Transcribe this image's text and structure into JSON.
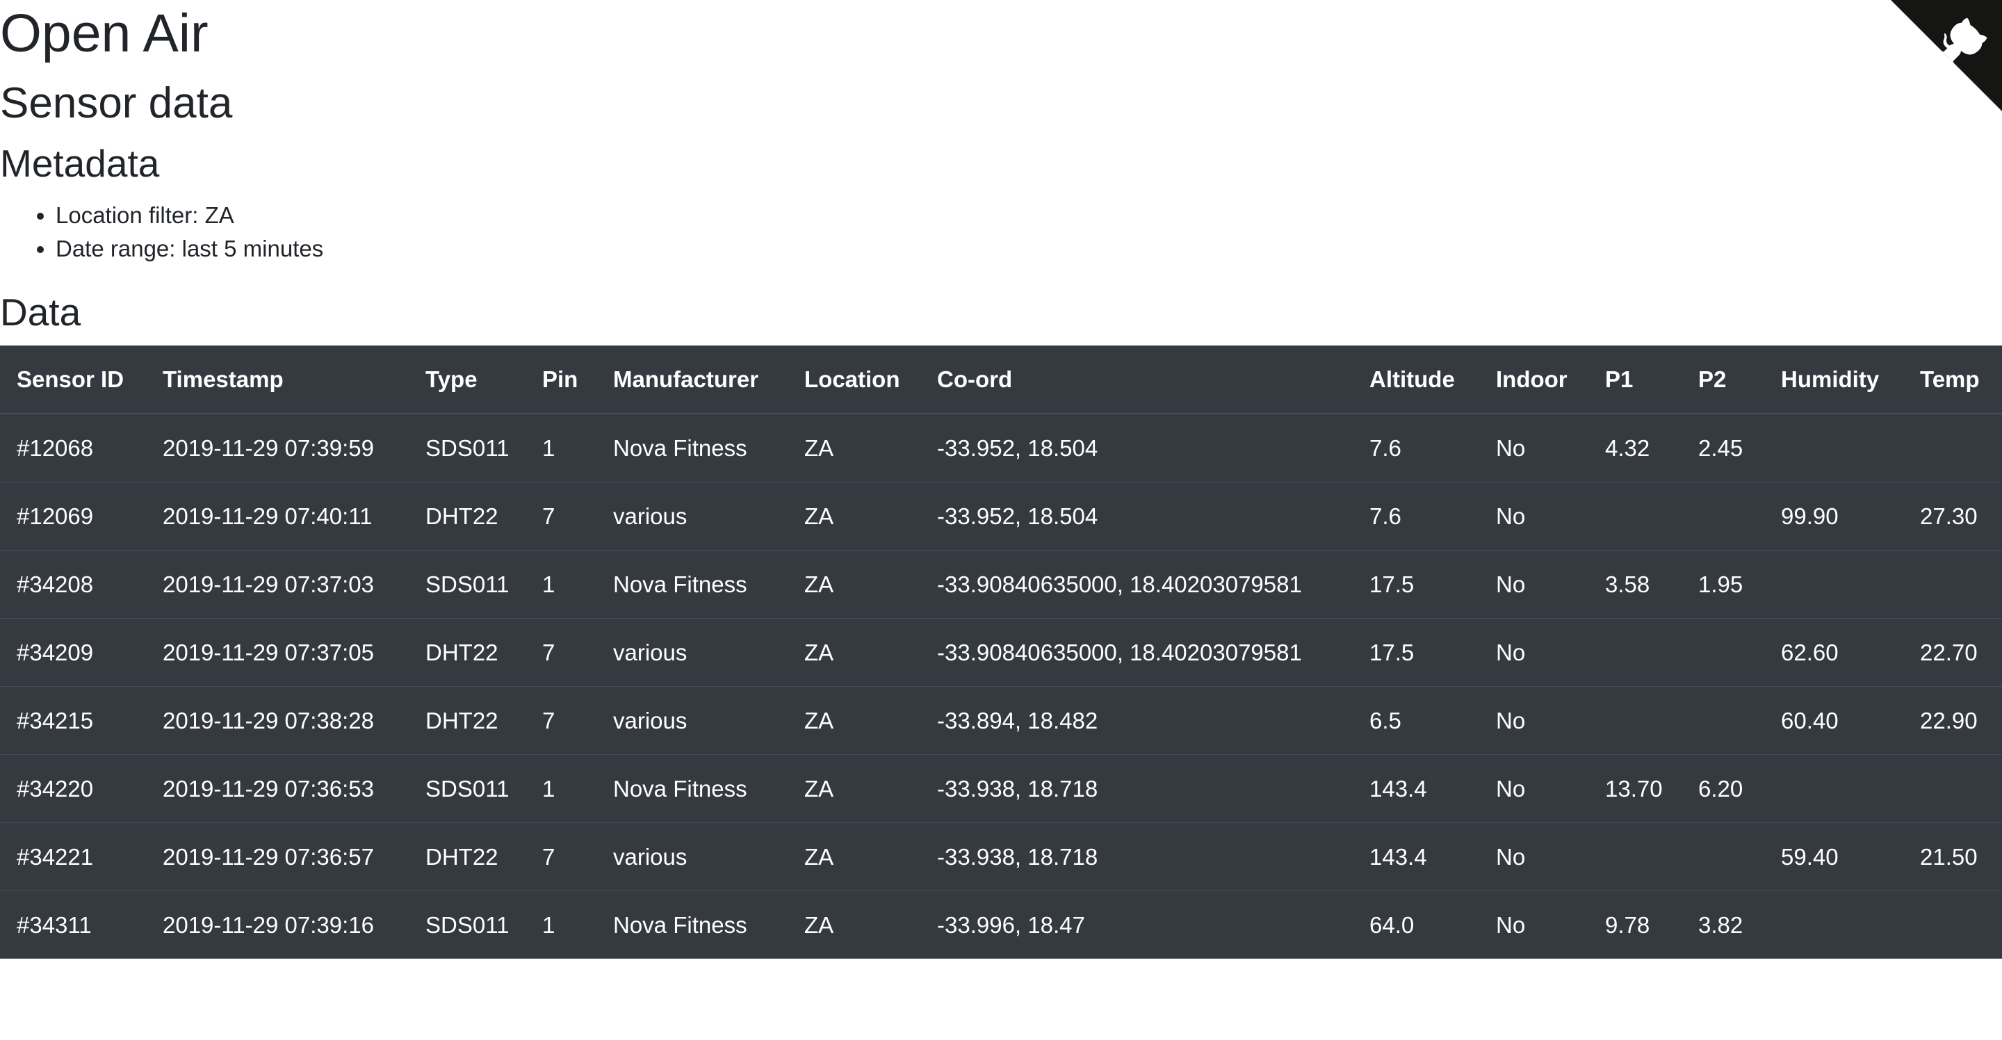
{
  "header": {
    "title": "Open Air",
    "subtitle": "Sensor data"
  },
  "metadata": {
    "heading": "Metadata",
    "items": [
      "Location filter: ZA",
      "Date range: last 5 minutes"
    ]
  },
  "data": {
    "heading": "Data",
    "columns": [
      "Sensor ID",
      "Timestamp",
      "Type",
      "Pin",
      "Manufacturer",
      "Location",
      "Co-ord",
      "Altitude",
      "Indoor",
      "P1",
      "P2",
      "Humidity",
      "Temp"
    ],
    "rows": [
      [
        "#12068",
        "2019-11-29 07:39:59",
        "SDS011",
        "1",
        "Nova Fitness",
        "ZA",
        "-33.952, 18.504",
        "7.6",
        "No",
        "4.32",
        "2.45",
        "",
        ""
      ],
      [
        "#12069",
        "2019-11-29 07:40:11",
        "DHT22",
        "7",
        "various",
        "ZA",
        "-33.952, 18.504",
        "7.6",
        "No",
        "",
        "",
        "99.90",
        "27.30"
      ],
      [
        "#34208",
        "2019-11-29 07:37:03",
        "SDS011",
        "1",
        "Nova Fitness",
        "ZA",
        "-33.90840635000, 18.40203079581",
        "17.5",
        "No",
        "3.58",
        "1.95",
        "",
        ""
      ],
      [
        "#34209",
        "2019-11-29 07:37:05",
        "DHT22",
        "7",
        "various",
        "ZA",
        "-33.90840635000, 18.40203079581",
        "17.5",
        "No",
        "",
        "",
        "62.60",
        "22.70"
      ],
      [
        "#34215",
        "2019-11-29 07:38:28",
        "DHT22",
        "7",
        "various",
        "ZA",
        "-33.894, 18.482",
        "6.5",
        "No",
        "",
        "",
        "60.40",
        "22.90"
      ],
      [
        "#34220",
        "2019-11-29 07:36:53",
        "SDS011",
        "1",
        "Nova Fitness",
        "ZA",
        "-33.938, 18.718",
        "143.4",
        "No",
        "13.70",
        "6.20",
        "",
        ""
      ],
      [
        "#34221",
        "2019-11-29 07:36:57",
        "DHT22",
        "7",
        "various",
        "ZA",
        "-33.938, 18.718",
        "143.4",
        "No",
        "",
        "",
        "59.40",
        "21.50"
      ],
      [
        "#34311",
        "2019-11-29 07:39:16",
        "SDS011",
        "1",
        "Nova Fitness",
        "ZA",
        "-33.996, 18.47",
        "64.0",
        "No",
        "9.78",
        "3.82",
        "",
        ""
      ]
    ]
  },
  "corner": {
    "icon": "github-octocat-icon",
    "color": "#151513"
  }
}
